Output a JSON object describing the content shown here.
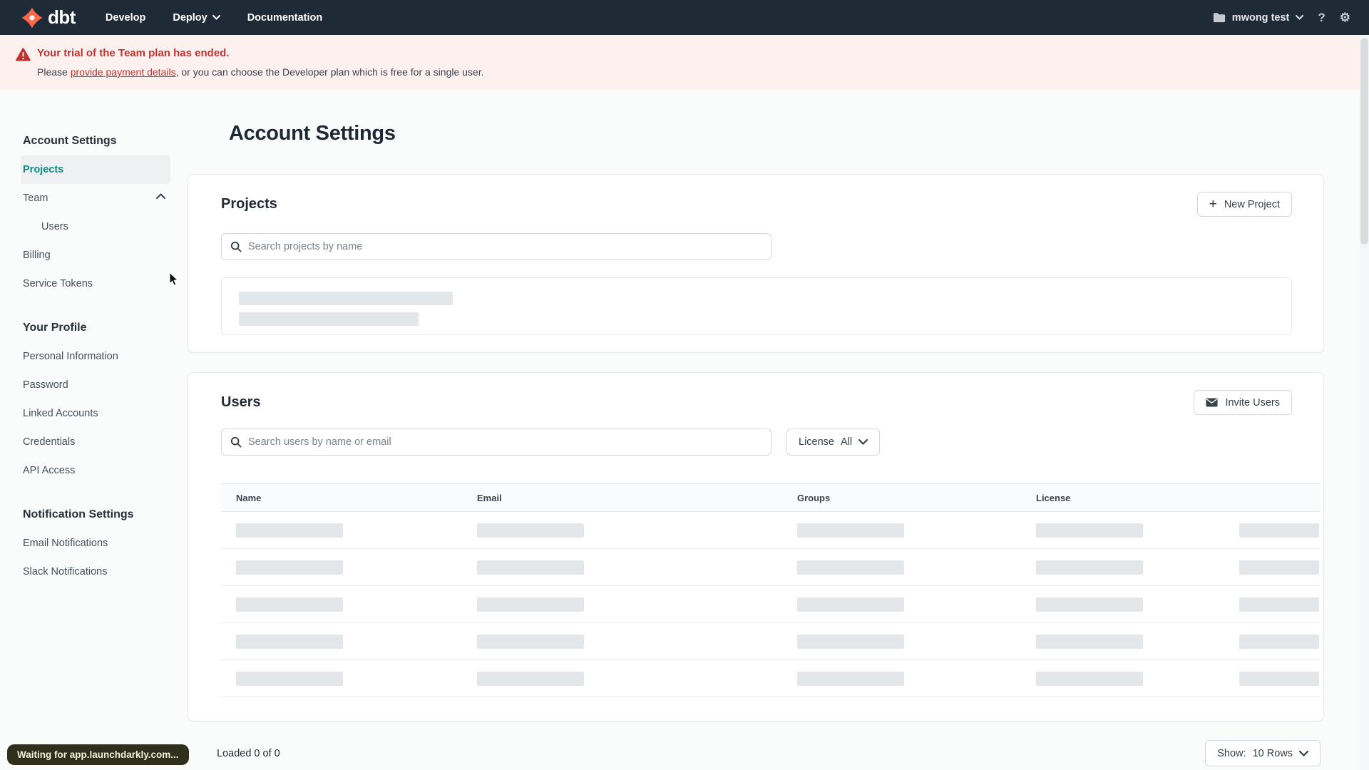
{
  "navbar": {
    "brand": "dbt",
    "menu": [
      {
        "label": "Develop"
      },
      {
        "label": "Deploy"
      },
      {
        "label": "Documentation"
      }
    ],
    "account_name": "mwong test",
    "help_label": "?",
    "gear_glyph": "⚙"
  },
  "banner": {
    "title": "Your trial of the Team plan has ended.",
    "body_prefix": "Please ",
    "link_text": "provide payment details",
    "body_suffix": ", or you can choose the Developer plan which is free for a single user."
  },
  "sidebar": {
    "sections": [
      {
        "heading": "Account Settings",
        "items": [
          {
            "label": "Projects"
          },
          {
            "label": "Team"
          },
          {
            "label": "Users"
          },
          {
            "label": "Billing"
          },
          {
            "label": "Service Tokens"
          }
        ]
      },
      {
        "heading": "Your Profile",
        "items": [
          {
            "label": "Personal Information"
          },
          {
            "label": "Password"
          },
          {
            "label": "Linked Accounts"
          },
          {
            "label": "Credentials"
          },
          {
            "label": "API Access"
          }
        ]
      },
      {
        "heading": "Notification Settings",
        "items": [
          {
            "label": "Email Notifications"
          },
          {
            "label": "Slack Notifications"
          }
        ]
      }
    ]
  },
  "main": {
    "title": "Account Settings",
    "projects": {
      "title": "Projects",
      "new_button": "New Project",
      "search_placeholder": "Search projects by name"
    },
    "users": {
      "title": "Users",
      "invite_button": "Invite Users",
      "search_placeholder": "Search users by name or email",
      "license_filter": {
        "label": "License",
        "value": "All"
      },
      "table": {
        "columns": [
          "Name",
          "Email",
          "Groups",
          "License"
        ]
      },
      "footer": {
        "loaded": "Loaded 0 of 0",
        "show_label": "Show:",
        "show_value": "10 Rows"
      }
    }
  },
  "status_bar": {
    "text": "Waiting for app.launchdarkly.com..."
  },
  "colors": {
    "brand_orange": "#ff694a",
    "navbar_bg": "#1e2a36",
    "warning_red": "#bf3430",
    "banner_bg": "#fcf1ef",
    "active_teal": "#0e8c84",
    "skeleton_gray": "#e4e7ea"
  }
}
